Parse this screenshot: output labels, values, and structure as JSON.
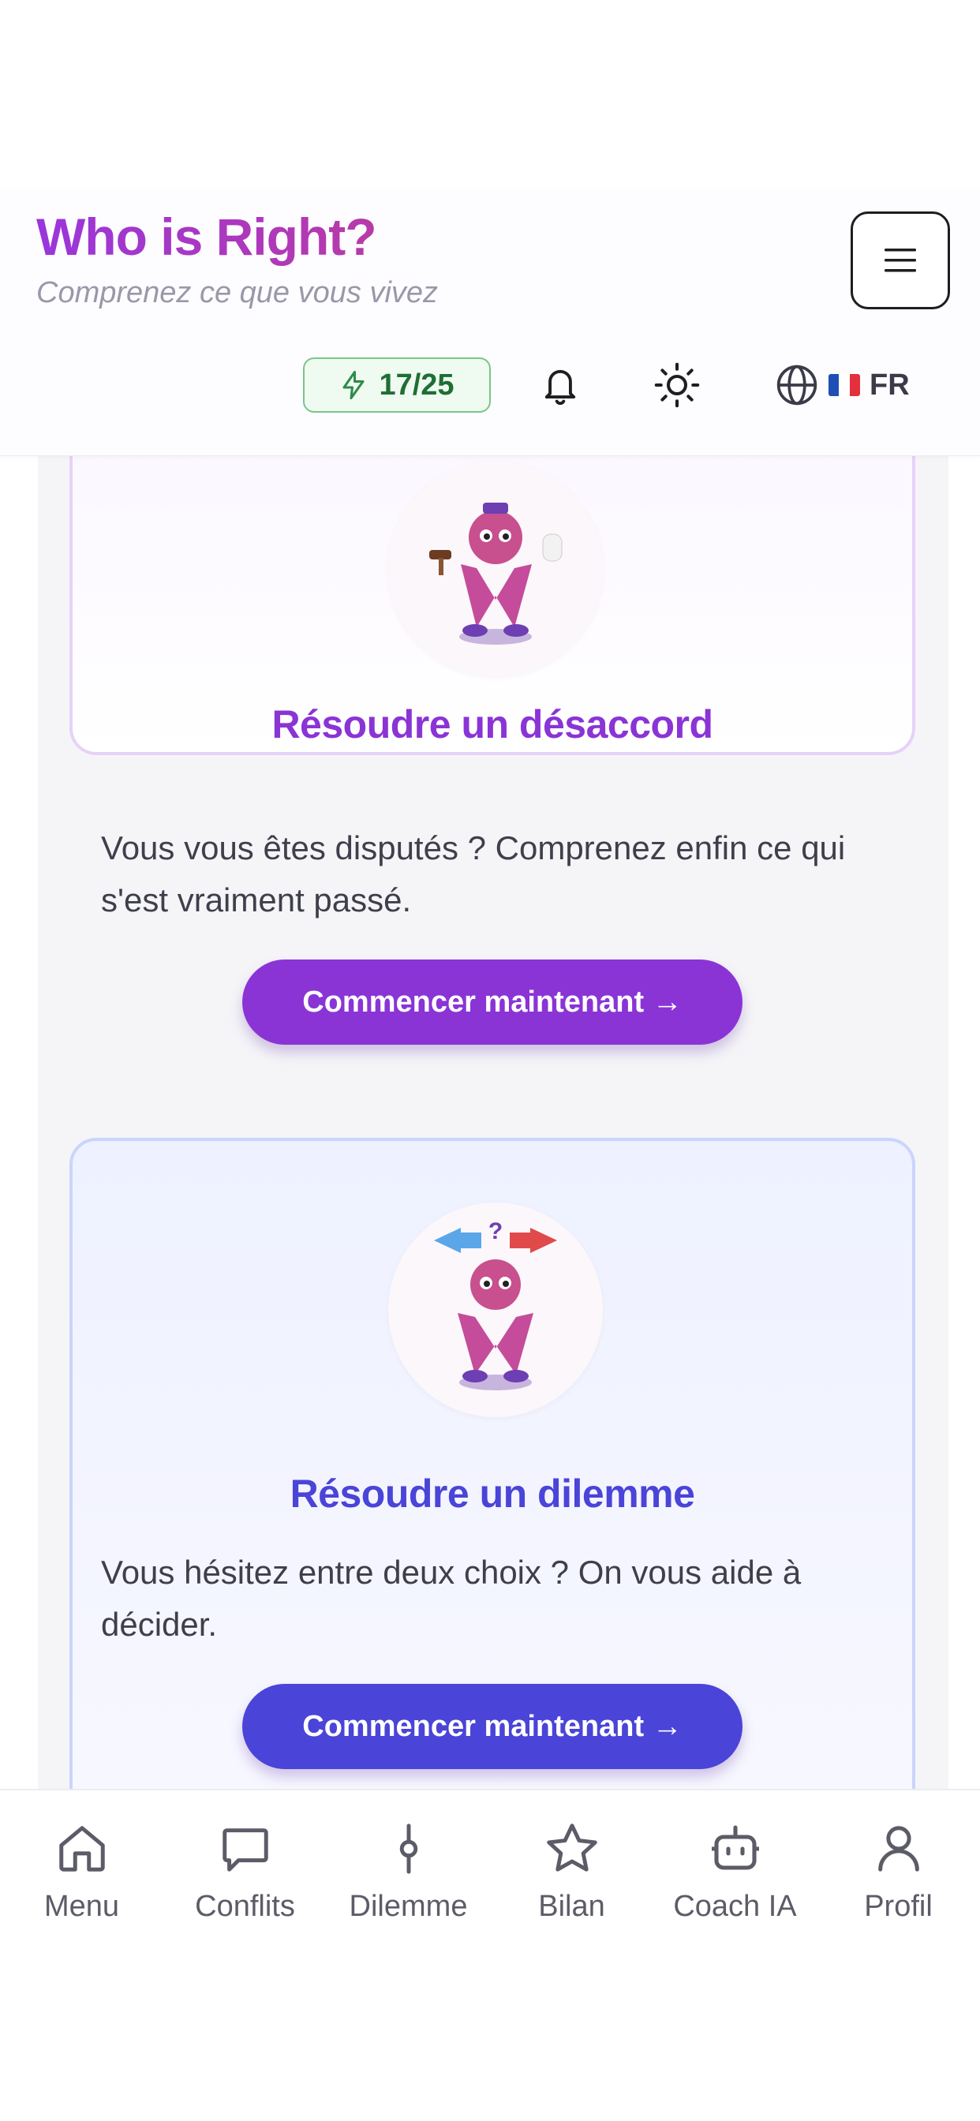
{
  "header": {
    "title": "Who is Right?",
    "subtitle": "Comprenez ce que vous vivez",
    "credits": "17/25",
    "language": "FR",
    "icons": {
      "menu": "hamburger-icon",
      "credits": "lightning-icon",
      "notifications": "bell-icon",
      "theme": "sun-icon",
      "language": "globe-icon",
      "flag": "france-flag-icon"
    }
  },
  "cards": [
    {
      "title": "Résoudre un désaccord",
      "description": "Vous vous êtes disputés ? Comprenez enfin ce qui s'est vraiment passé.",
      "button": "Commencer maintenant →",
      "accent": "#8a34d6",
      "mascot": "judge-mascot-image"
    },
    {
      "title": "Résoudre un dilemme",
      "description": "Vous hésitez entre deux choix ? On vous aide à décider.",
      "button": "Commencer maintenant →",
      "accent": "#4a44d8",
      "mascot": "dilemma-mascot-image"
    }
  ],
  "nav": [
    {
      "label": "Menu",
      "icon": "home-icon"
    },
    {
      "label": "Conflits",
      "icon": "chat-bubble-icon"
    },
    {
      "label": "Dilemme",
      "icon": "balance-icon"
    },
    {
      "label": "Bilan",
      "icon": "star-icon"
    },
    {
      "label": "Coach IA",
      "icon": "robot-icon"
    },
    {
      "label": "Profil",
      "icon": "user-icon"
    }
  ],
  "colors": {
    "brand_gradient_start": "#9a36dc",
    "brand_gradient_end": "#b83aa8",
    "credits_green": "#1f6f33",
    "nav_text": "#5c5c68"
  }
}
